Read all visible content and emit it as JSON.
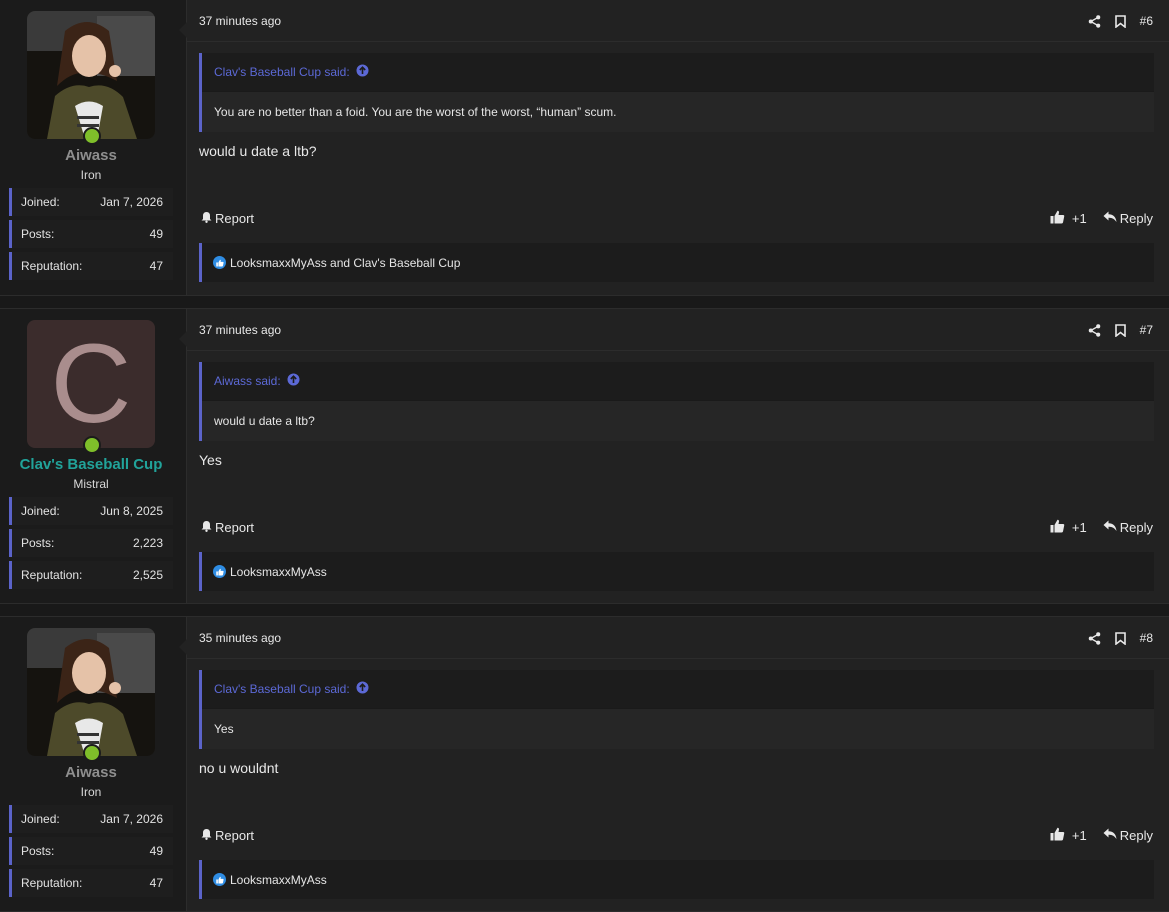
{
  "posts": [
    {
      "user": {
        "name": "Aiwass",
        "title": "Iron",
        "joined_label": "Joined:",
        "joined": "Jan 7, 2026",
        "posts_label": "Posts:",
        "posts": "49",
        "rep_label": "Reputation:",
        "reputation": "47"
      },
      "time": "37 minutes ago",
      "number": "#6",
      "quote": {
        "author": "Clav's Baseball Cup said:",
        "text": "You are no better than a foid. You are the worst of the worst, “human” scum."
      },
      "text": "would u date a ltb?",
      "report": "Report",
      "like_count": "+1",
      "reply": "Reply",
      "likes": "LooksmaxxMyAss and Clav's Baseball Cup"
    },
    {
      "user": {
        "name": "Clav's Baseball Cup",
        "title": "Mistral",
        "letter": "C",
        "joined_label": "Joined:",
        "joined": "Jun 8, 2025",
        "posts_label": "Posts:",
        "posts": "2,223",
        "rep_label": "Reputation:",
        "reputation": "2,525"
      },
      "time": "37 minutes ago",
      "number": "#7",
      "quote": {
        "author": "Aiwass said:",
        "text": "would u date a ltb?"
      },
      "text": "Yes",
      "report": "Report",
      "like_count": "+1",
      "reply": "Reply",
      "likes": "LooksmaxxMyAss"
    },
    {
      "user": {
        "name": "Aiwass",
        "title": "Iron",
        "joined_label": "Joined:",
        "joined": "Jan 7, 2026",
        "posts_label": "Posts:",
        "posts": "49",
        "rep_label": "Reputation:",
        "reputation": "47"
      },
      "time": "35 minutes ago",
      "number": "#8",
      "quote": {
        "author": "Clav's Baseball Cup said:",
        "text": "Yes"
      },
      "text": "no u wouldnt",
      "report": "Report",
      "like_count": "+1",
      "reply": "Reply",
      "likes": "LooksmaxxMyAss"
    }
  ],
  "colors": {
    "accent": "#5b63c9",
    "online": "#7fbf2a",
    "teal_username": "#21a39a",
    "like_blue": "#2f8de4"
  },
  "icons": [
    "share-icon",
    "bookmark-icon",
    "bell-icon",
    "thumbs-up-icon",
    "reply-icon",
    "arrow-up-circle-icon"
  ]
}
